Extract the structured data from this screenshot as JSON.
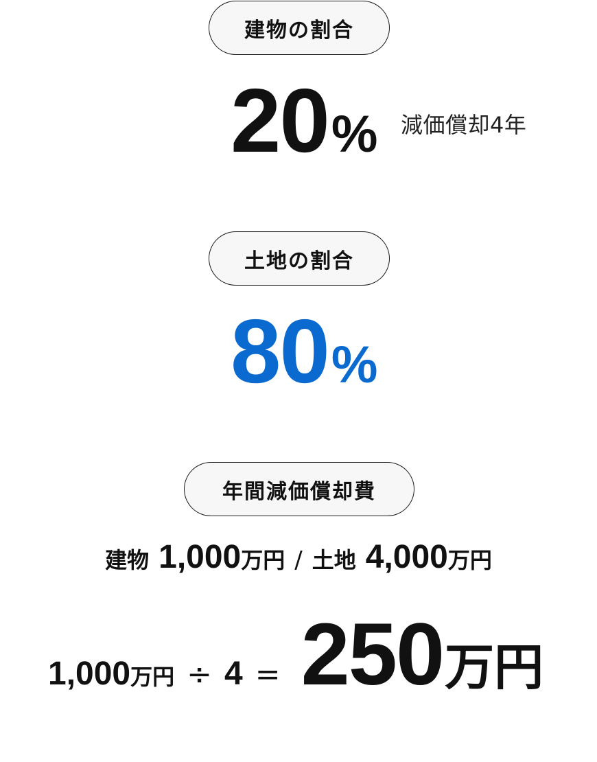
{
  "colors": {
    "accent_blue": "#0a6ad0",
    "text": "#111111",
    "pill_bg": "#f7f7f7",
    "pill_border": "#1a1a1a"
  },
  "building_share": {
    "label": "建物の割合",
    "value": "20",
    "unit": "%",
    "note": "減価償却4年"
  },
  "land_share": {
    "label": "土地の割合",
    "value": "80",
    "unit": "%"
  },
  "annual_depreciation": {
    "label": "年間減価償却費",
    "prices": {
      "building_label": "建物",
      "building_amount": "1,000",
      "building_unit": "万円",
      "separator": "/",
      "land_label": "土地",
      "land_amount": "4,000",
      "land_unit": "万円"
    },
    "formula": {
      "amount": "1,000",
      "amount_unit": "万円",
      "divide": "÷",
      "years": "4",
      "equals": "=",
      "result": "250",
      "result_unit": "万円"
    }
  }
}
